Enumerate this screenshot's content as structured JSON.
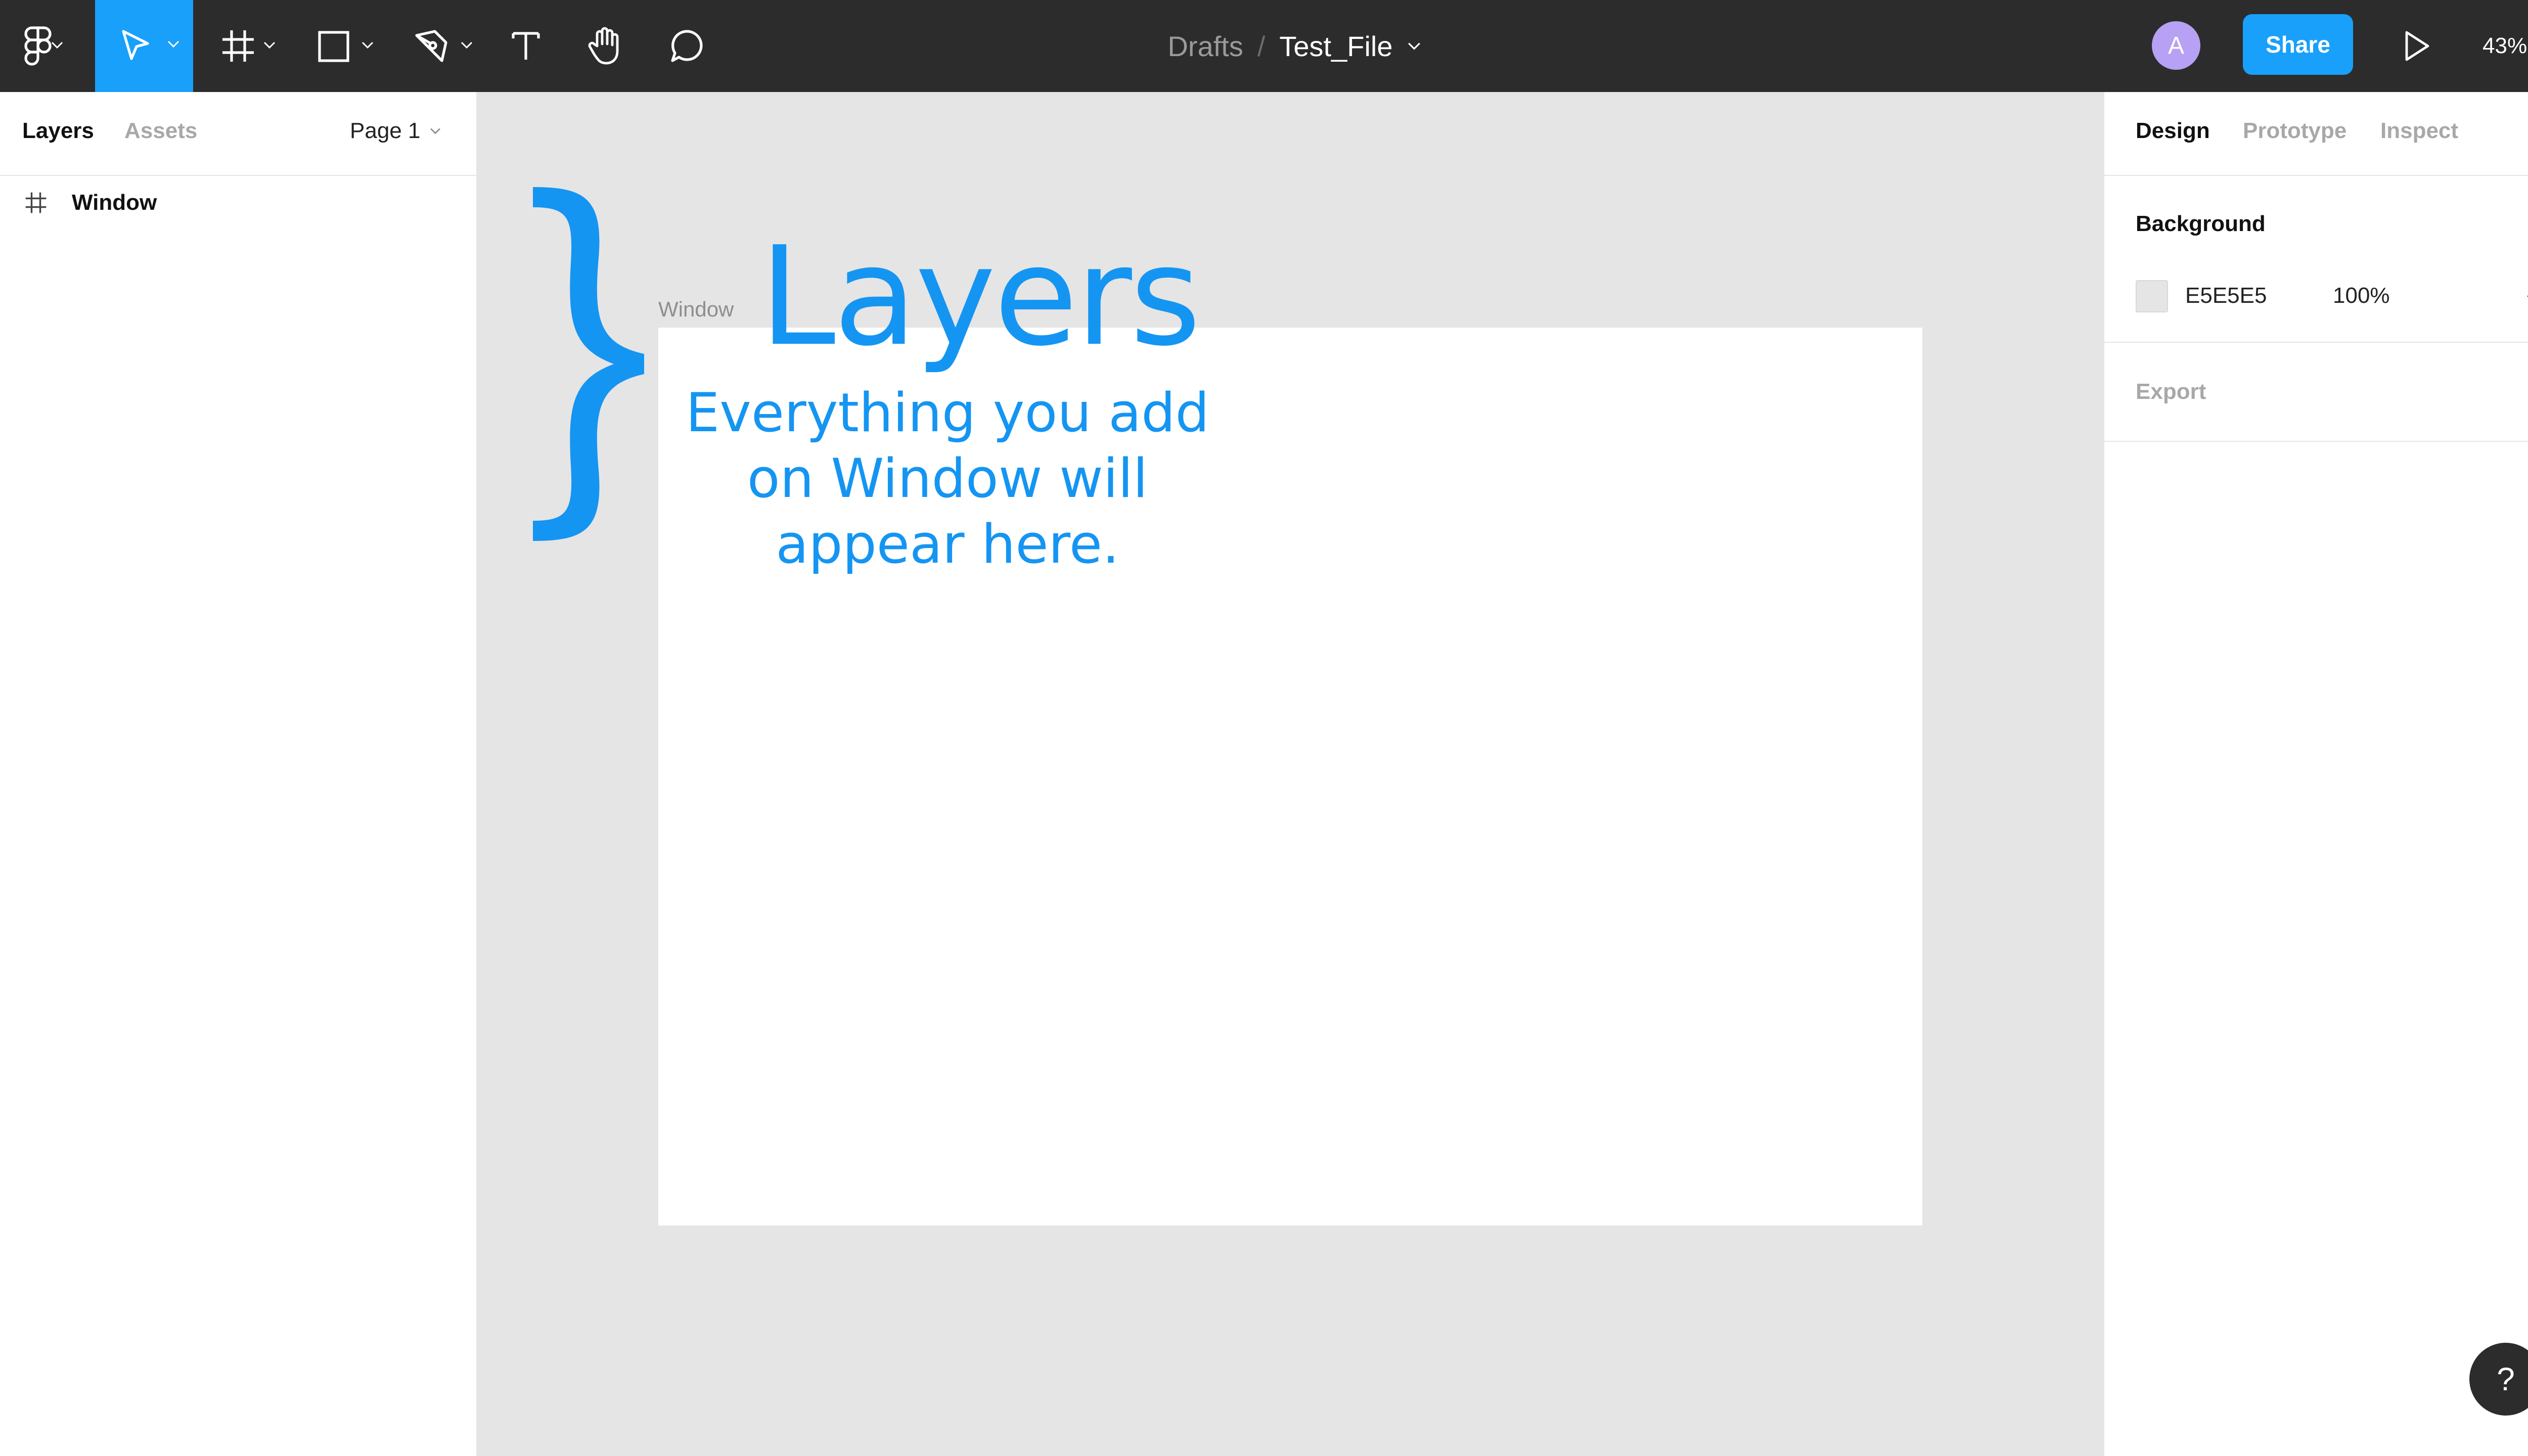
{
  "toolbar": {
    "breadcrumb_parent": "Drafts",
    "breadcrumb_separator": "/",
    "file_name": "Test_File",
    "avatar_initial": "A",
    "share_label": "Share",
    "zoom_level": "43%",
    "active_tool": "move-tool",
    "active_color": "#18a0fb"
  },
  "left_panel": {
    "tabs": [
      {
        "label": "Layers",
        "active": true
      },
      {
        "label": "Assets",
        "active": false
      }
    ],
    "page_selector": "Page 1",
    "layers": [
      {
        "name": "Window",
        "icon": "frame-icon"
      }
    ]
  },
  "canvas": {
    "frame_label": "Window",
    "background_color": "#e5e5e5",
    "annotation_title": "Layers",
    "annotation_text": "Everything you add on Window will appear here.",
    "annotation_color": "#1595f2"
  },
  "right_panel": {
    "tabs": [
      {
        "label": "Design",
        "active": true
      },
      {
        "label": "Prototype",
        "active": false
      },
      {
        "label": "Inspect",
        "active": false
      }
    ],
    "background": {
      "title": "Background",
      "hex": "E5E5E5",
      "opacity": "100%"
    },
    "export": {
      "title": "Export"
    }
  },
  "help_label": "?"
}
